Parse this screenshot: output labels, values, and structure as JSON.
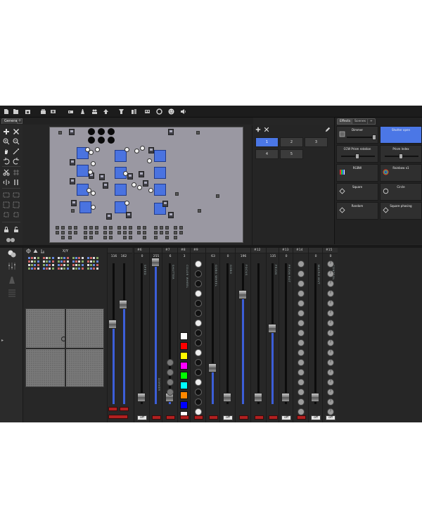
{
  "layout_tab": "General",
  "layout_tab_add": "+",
  "effects_tabs": [
    "Effects",
    "Scenes",
    "+"
  ],
  "scenes": [
    "1",
    "2",
    "3",
    "4",
    "5"
  ],
  "effects": [
    {
      "name": "Dimmer",
      "active": false
    },
    {
      "name": "Shutter open",
      "active": true
    },
    {
      "name": "CCW Prism rotation",
      "active": false
    },
    {
      "name": "Prism Index",
      "active": false
    },
    {
      "name": "RGBW",
      "active": false
    },
    {
      "name": "Rainbow x1",
      "active": false
    },
    {
      "name": "Square",
      "active": false
    },
    {
      "name": "Circle",
      "active": false
    },
    {
      "name": "Random",
      "active": false
    },
    {
      "name": "Square phasing",
      "active": false
    }
  ],
  "xy_title": "X/Y",
  "xy_values": {
    "x": "116",
    "y": "162"
  },
  "channels": [
    {
      "label": "#6",
      "value": "0",
      "name": "SPEED",
      "fill": 0.0,
      "has_off": true
    },
    {
      "label": "",
      "value": "255",
      "name": "DIMMER",
      "fill": 1.0,
      "has_off": false
    },
    {
      "label": "#7",
      "value": "6",
      "name": "SHUTTER",
      "fill": 0.02,
      "has_off": false
    },
    {
      "label": "#8",
      "value": "3",
      "name": "COLOR WHEEL",
      "fill": 0.01,
      "has_off": false
    },
    {
      "label": "#9",
      "value": "",
      "name": "",
      "fill": 0.0,
      "has_off": false
    },
    {
      "label": "",
      "value": "63",
      "name": "GOBO WHEEL",
      "fill": 0.25,
      "has_off": false
    },
    {
      "label": "",
      "value": "0",
      "name": "GOBO",
      "fill": 0.0,
      "has_off": true
    },
    {
      "label": "",
      "value": "196",
      "name": "FOCUS",
      "fill": 0.77,
      "has_off": false
    },
    {
      "label": "#12",
      "value": "",
      "name": "",
      "fill": 0.0,
      "has_off": false
    },
    {
      "label": "",
      "value": "135",
      "name": "PRISM",
      "fill": 0.53,
      "has_off": false
    },
    {
      "label": "#13",
      "value": "0",
      "name": "PRISM ROT",
      "fill": 0.0,
      "has_off": true
    },
    {
      "label": "#14",
      "value": "",
      "name": "",
      "fill": 0.0,
      "has_off": false
    },
    {
      "label": "",
      "value": "0",
      "name": "MACRO MVT",
      "fill": 0.0,
      "has_off": true
    },
    {
      "label": "#15",
      "value": "0",
      "name": "CONTROL",
      "fill": 0.0,
      "has_off": true
    }
  ],
  "off_label": "off",
  "color_swatches": [
    "#ffffff",
    "#ff0000",
    "#ffff00",
    "#ff00ff",
    "#00ff00",
    "#00ffff",
    "#ff8800",
    "#0000ff",
    "#ffffff"
  ],
  "colors": {
    "accent": "#4b77e6",
    "fader_fill": "#3c5ed8",
    "plan_bg": "#9a98a2",
    "alert_red": "#b12020"
  },
  "toolbar_icons": [
    "new-file-icon",
    "open-icon",
    "open-recent-icon",
    "save-icon",
    "export-icon",
    "fixture-icon",
    "beam-icon",
    "group-icon",
    "arrow-up-icon",
    "patch-icon",
    "settings-icon",
    "palette-icon",
    "link-icon",
    "smiley-icon",
    "speaker-icon"
  ]
}
